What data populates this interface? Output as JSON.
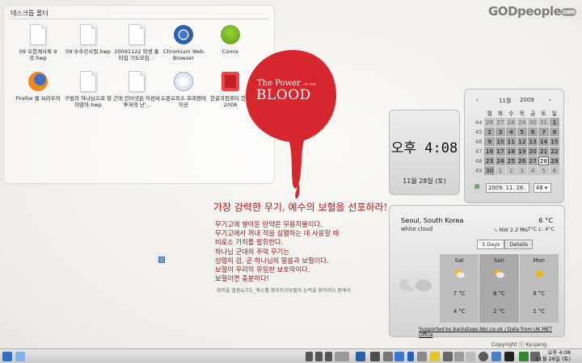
{
  "folder": {
    "title": "데스크톱 폴더",
    "items": [
      {
        "label": "09 오한계사록 9강.hwp",
        "icon": "document-icon"
      },
      {
        "label": "09 수수강사절.hwp",
        "icon": "document-icon"
      },
      {
        "label": "20091122 학생 홀티입 기도모임...",
        "icon": "document-icon"
      },
      {
        "label": "Chromium Web Browser",
        "icon": "chromium-icon"
      },
      {
        "label": "Comix",
        "icon": "comix-icon"
      },
      {
        "label": "Firefox 웹 브라우저",
        "icon": "firefox-icon"
      },
      {
        "label": "구원의 하나님으로 할미암아.hwp",
        "icon": "document-icon"
      },
      {
        "label": "근래 인터넷은 이른바 '투저의 난'...",
        "icon": "document-icon"
      },
      {
        "label": "오픈오피스 프레젠테이션",
        "icon": "openoffice-icon"
      },
      {
        "label": "한글과컴퓨터 한글 2008",
        "icon": "hangul-icon"
      }
    ]
  },
  "brand": {
    "name": "GODpeople",
    "suffix": "com"
  },
  "logo": {
    "line1": "The Power",
    "of": "OF THE",
    "line2": "BLOOD"
  },
  "headline": "가장 강력한 무기, 예수의 보혈을 선포하라!",
  "body_lines": [
    "무기고에 쌓아둔 탄약은 무용지물이다.",
    "무기고에서 꺼내 적을 섬멸하는 데 사용할 때",
    "비로소 가치를 발휘한다.",
    "하나님 군대의 주력 무기는",
    "성령의 검, 곧 하나님의 말씀과 보혈이다.",
    "보혈이 우리의 유일한 보호막이다.",
    "보혈이면 충분하다!"
  ],
  "citation": "징미을 말씀&기도_액스웰 화이트(《보혈의 능력을 취하라》) 중에서",
  "clock": {
    "time": "오후 4:08",
    "date": "11월 28일 (토)"
  },
  "calendar": {
    "month": "11월",
    "year": "2009",
    "weekdays": [
      "월",
      "화",
      "수",
      "목",
      "금",
      "토",
      "일"
    ],
    "rows": [
      {
        "week": "44",
        "days": [
          "26",
          "27",
          "28",
          "29",
          "30",
          "31",
          "1"
        ],
        "other": [
          0,
          1,
          2,
          3,
          4,
          5
        ]
      },
      {
        "week": "45",
        "days": [
          "2",
          "3",
          "4",
          "5",
          "6",
          "7",
          "8"
        ],
        "other": []
      },
      {
        "week": "46",
        "days": [
          "9",
          "10",
          "11",
          "12",
          "13",
          "14",
          "15"
        ],
        "other": []
      },
      {
        "week": "47",
        "days": [
          "16",
          "17",
          "18",
          "19",
          "20",
          "21",
          "22"
        ],
        "other": []
      },
      {
        "week": "48",
        "days": [
          "23",
          "24",
          "25",
          "26",
          "27",
          "28",
          "29"
        ],
        "other": [],
        "today": 5
      },
      {
        "week": "49",
        "days": [
          "30",
          "1",
          "2",
          "3",
          "4",
          "5",
          "6"
        ],
        "other": [
          1,
          2,
          3,
          4,
          5,
          6
        ]
      }
    ],
    "date_field": "2009. 11. 28.",
    "week_field": "48"
  },
  "weather": {
    "city": "Seoul, South Korea",
    "condition": "white cloud",
    "temp": "6 °C",
    "hilo": "H: 7°C L: 4°C",
    "wind": "NW 2.2 ms",
    "tab_3days": "3 Days",
    "tab_details": "Details",
    "days": [
      {
        "name": "Sat",
        "hi": "7 °C",
        "lo": "4 °C",
        "icon": "partly-cloudy-icon"
      },
      {
        "name": "Sun",
        "hi": "8 °C",
        "lo": "2 °C",
        "icon": "partly-cloudy-icon"
      },
      {
        "name": "Mon",
        "hi": "8 °C",
        "lo": "1 °C",
        "icon": "sun-icon"
      }
    ],
    "credit": "Supported by backstage.bbc.co.uk / Data from UK MET Office"
  },
  "copyright": "Copyright ⓒ Kyujang",
  "taskbar": {
    "time": "오후 4:08",
    "date": "11월 28일 (토)"
  },
  "colors": {
    "blood": "#d7262e",
    "text_red": "#b81414"
  }
}
